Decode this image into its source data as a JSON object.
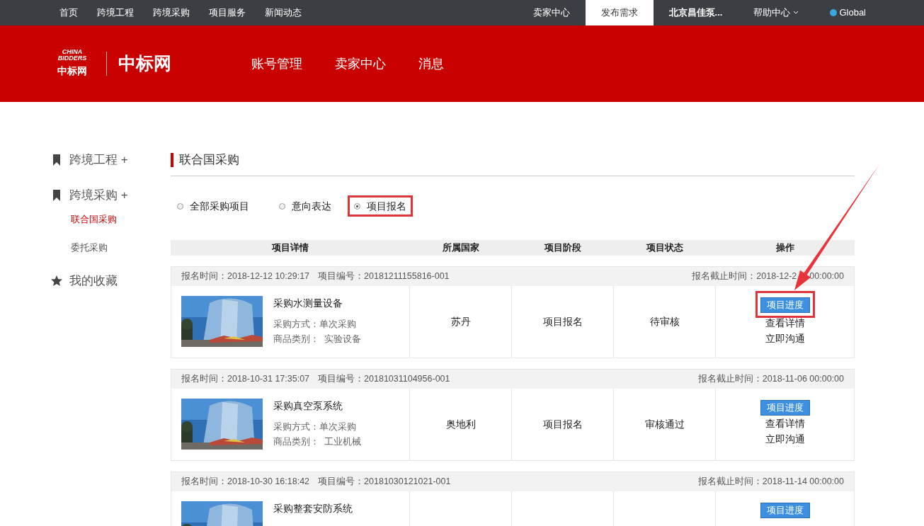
{
  "top_nav": {
    "left": [
      "首页",
      "跨境工程",
      "跨境采购",
      "项目服务",
      "新闻动态"
    ],
    "right": [
      {
        "label": "卖家中心",
        "selected": false
      },
      {
        "label": "发布需求",
        "selected": true
      },
      {
        "label": "北京昌佳泵...",
        "selected": false,
        "kind": "user"
      },
      {
        "label": "帮助中心",
        "selected": false,
        "kind": "dropdown"
      },
      {
        "label": "Global",
        "selected": false,
        "kind": "globe"
      }
    ]
  },
  "header": {
    "logo_text": "中标网",
    "logo_small": "中标网",
    "logo_en": "CHINA BIDDERS",
    "nav": [
      "账号管理",
      "卖家中心",
      "消息"
    ]
  },
  "sidebar": [
    {
      "label": "跨境工程 +",
      "kind": "bookmark"
    },
    {
      "label": "跨境采购 +",
      "kind": "bookmark",
      "children": [
        {
          "label": "联合国采购",
          "selected": true
        },
        {
          "label": "委托采购",
          "selected": false
        }
      ]
    },
    {
      "label": "我的收藏",
      "kind": "star"
    }
  ],
  "section_title": "联合国采购",
  "filters": [
    {
      "label": "全部采购项目",
      "selected": false,
      "highlighted": false
    },
    {
      "label": "意向表达",
      "selected": false,
      "highlighted": false
    },
    {
      "label": "项目报名",
      "selected": true,
      "highlighted": true
    }
  ],
  "table": {
    "columns": [
      "项目详情",
      "所属国家",
      "项目阶段",
      "项目状态",
      "操作"
    ],
    "rows": [
      {
        "signup_time": "报名时间：2018-12-12 10:29:17",
        "project_no": "项目编号：20181211155816-001",
        "deadline": "报名截止时间：2018-12-2",
        "deadline_time": "00:00:00",
        "title": "采购水测量设备",
        "method": "采购方式：单次采购",
        "category": "商品类别：  实验设备",
        "country": "苏丹",
        "stage": "项目报名",
        "status": "待审核",
        "actions": [
          "项目进度",
          "查看详情",
          "立即沟通"
        ],
        "highlighted": true
      },
      {
        "signup_time": "报名时间：2018-10-31 17:35:07",
        "project_no": "项目编号：20181031104956-001",
        "deadline": "报名截止时间：2018-11-06 00:00:00",
        "title": "采购真空泵系统",
        "method": "采购方式：单次采购",
        "category": "商品类别：  工业机械",
        "country": "奥地利",
        "stage": "项目报名",
        "status": "审核通过",
        "actions": [
          "项目进度",
          "查看详情",
          "立即沟通"
        ],
        "highlighted": false
      },
      {
        "signup_time": "报名时间：2018-10-30 16:18:42",
        "project_no": "项目编号：20181030121021-001",
        "deadline": "报名截止时间：2018-11-14 00:00:00",
        "title": "采购整套安防系统",
        "actions": [
          "项目进度"
        ],
        "highlighted": false
      }
    ]
  }
}
